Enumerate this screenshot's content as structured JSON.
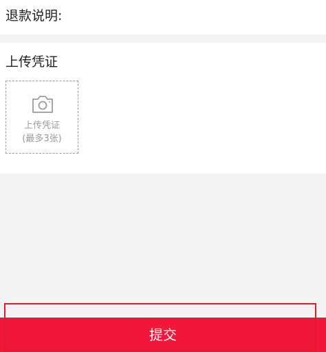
{
  "refund": {
    "note_label": "退款说明:"
  },
  "upload": {
    "title": "上传凭证",
    "box_label": "上传凭证",
    "box_sublabel": "(最多3张)",
    "icon": "camera-icon"
  },
  "footer": {
    "submit_label": "提交"
  },
  "colors": {
    "accent": "#f2163a",
    "background": "#f3f3f3",
    "muted_text": "#9a9a9a"
  }
}
